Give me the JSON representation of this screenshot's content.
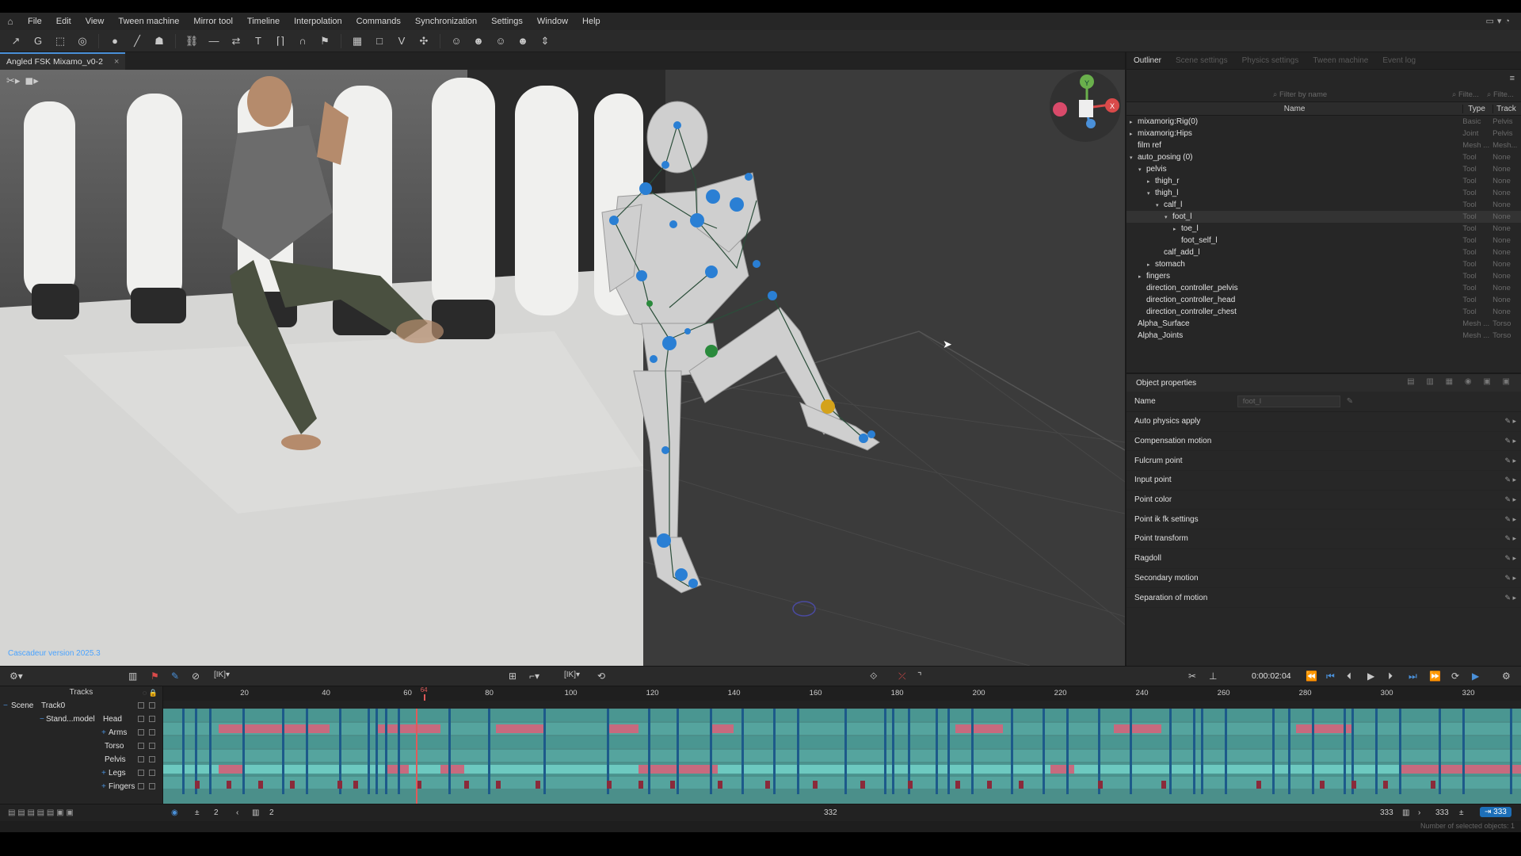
{
  "menu": [
    "File",
    "Edit",
    "View",
    "Tween machine",
    "Mirror tool",
    "Timeline",
    "Interpolation",
    "Commands",
    "Synchronization",
    "Settings",
    "Window",
    "Help"
  ],
  "document_tab": "Angled FSK Mixamo_v0-2",
  "version_text": "Cascadeur version 2025.3",
  "right_tabs": [
    "Outliner",
    "Scene settings",
    "Physics settings",
    "Tween machine",
    "Event log"
  ],
  "filter": {
    "name_placeholder": "Filter by name",
    "type_placeholder": "Filte...",
    "track_placeholder": "Filte..."
  },
  "outliner_headers": {
    "name": "Name",
    "type": "Type",
    "track": "Track"
  },
  "outliner_rows": [
    {
      "name": "mixamorig:Rig(0)",
      "type": "Basic",
      "track": "Pelvis"
    },
    {
      "name": "mixamorig:Hips",
      "type": "Joint",
      "track": "Pelvis"
    },
    {
      "name": "film ref",
      "type": "Mesh ...",
      "track": "Mesh..."
    },
    {
      "name": "auto_posing (0)",
      "type": "Tool",
      "track": "None"
    },
    {
      "name": "pelvis",
      "type": "Tool",
      "track": "None"
    },
    {
      "name": "thigh_r",
      "type": "Tool",
      "track": "None"
    },
    {
      "name": "thigh_l",
      "type": "Tool",
      "track": "None"
    },
    {
      "name": "calf_l",
      "type": "Tool",
      "track": "None"
    },
    {
      "name": "foot_l",
      "type": "Tool",
      "track": "None"
    },
    {
      "name": "toe_l",
      "type": "Tool",
      "track": "None"
    },
    {
      "name": "foot_self_l",
      "type": "Tool",
      "track": "None"
    },
    {
      "name": "calf_add_l",
      "type": "Tool",
      "track": "None"
    },
    {
      "name": "stomach",
      "type": "Tool",
      "track": "None"
    },
    {
      "name": "fingers",
      "type": "Tool",
      "track": "None"
    },
    {
      "name": "direction_controller_pelvis",
      "type": "Tool",
      "track": "None"
    },
    {
      "name": "direction_controller_head",
      "type": "Tool",
      "track": "None"
    },
    {
      "name": "direction_controller_chest",
      "type": "Tool",
      "track": "None"
    },
    {
      "name": "Alpha_Surface",
      "type": "Mesh ...",
      "track": "Torso"
    },
    {
      "name": "Alpha_Joints",
      "type": "Mesh ...",
      "track": "Torso"
    }
  ],
  "object_properties": {
    "title": "Object properties",
    "name_label": "Name",
    "name_value": "foot_l",
    "rows": [
      "Auto physics apply",
      "Compensation motion",
      "Fulcrum point",
      "Input point",
      "Point color",
      "Point ik fk settings",
      "Point transform",
      "Ragdoll",
      "Secondary motion",
      "Separation of motion"
    ]
  },
  "transport": {
    "time": "0:00:02:04",
    "ik_label": "IK"
  },
  "tracks": {
    "title": "Tracks",
    "scene": "Scene",
    "track0": "Track0",
    "model": "Stand...model",
    "items": [
      "Head",
      "Arms",
      "Torso",
      "Pelvis",
      "Legs",
      "Fingers"
    ]
  },
  "ruler": {
    "ticks": [
      "20",
      "40",
      "60",
      "64",
      "80",
      "100",
      "120",
      "140",
      "160",
      "180",
      "200",
      "220",
      "240",
      "260",
      "280",
      "300",
      "320"
    ]
  },
  "bottom": {
    "left_a": "2",
    "left_b": "2",
    "center": "332",
    "right_a": "333",
    "right_b": "333",
    "right_c": "333"
  },
  "status_text": "Number of selected objects: 1",
  "colors": {
    "accent": "#4aa3ff",
    "teal": "#4fa8a3",
    "pink": "#c76a7e",
    "key_blue": "#1d5a8a",
    "joint_blue": "#2a7fd4",
    "joint_yellow": "#d4a21a"
  }
}
